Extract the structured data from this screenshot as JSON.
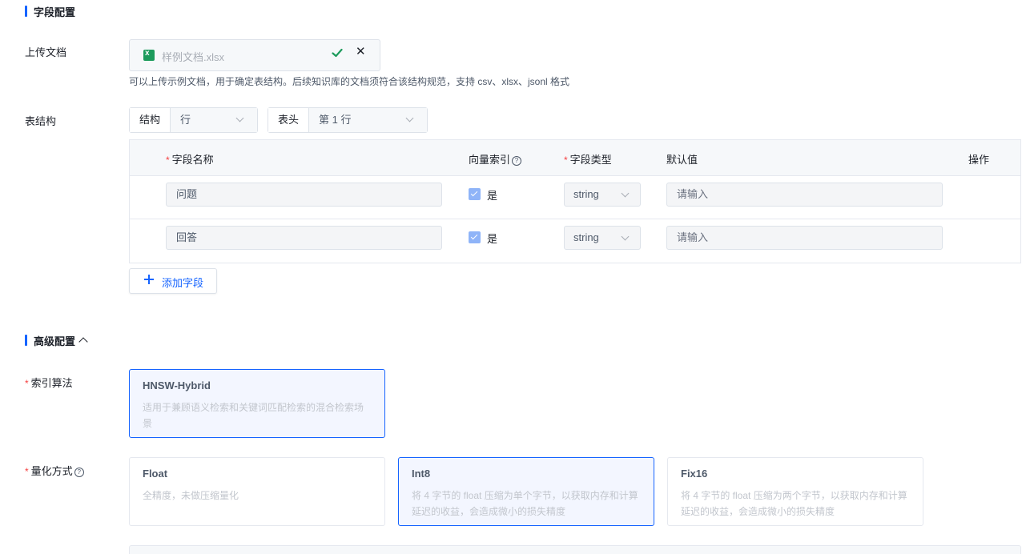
{
  "field_config": {
    "title": "字段配置"
  },
  "upload": {
    "label": "上传文档",
    "file_name": "样例文档.xlsx",
    "hint": "可以上传示例文档，用于确定表结构。后续知识库的文档须符合该结构规范，支持 csv、xlsx、jsonl 格式"
  },
  "table_structure": {
    "label": "表结构",
    "structure": {
      "label": "结构",
      "value": "行"
    },
    "header": {
      "label": "表头",
      "value": "第 1 行"
    }
  },
  "fields_table": {
    "columns": {
      "name": "字段名称",
      "vector_index": "向量索引",
      "type": "字段类型",
      "default": "默认值",
      "action": "操作"
    },
    "rows": [
      {
        "name": "问题",
        "vector_index_checked": true,
        "vector_index_label": "是",
        "type": "string",
        "default_placeholder": "请输入"
      },
      {
        "name": "回答",
        "vector_index_checked": true,
        "vector_index_label": "是",
        "type": "string",
        "default_placeholder": "请输入"
      }
    ]
  },
  "add_field_label": "添加字段",
  "advanced": {
    "title": "高级配置"
  },
  "index_algorithm": {
    "label": "索引算法",
    "options": [
      {
        "title": "HNSW-Hybrid",
        "desc": "适用于兼顾语义检索和关键词匹配检索的混合检索场景",
        "selected": true
      }
    ]
  },
  "quantization": {
    "label": "量化方式",
    "options": [
      {
        "title": "Float",
        "desc": "全精度，未做压缩量化",
        "selected": false
      },
      {
        "title": "Int8",
        "desc": "将 4 字节的 float 压缩为单个字节，以获取内存和计算延迟的收益，会造成微小的损失精度",
        "selected": true
      },
      {
        "title": "Fix16",
        "desc": "将 4 字节的 float 压缩为两个字节，以获取内存和计算延迟的收益，会造成微小的损失精度",
        "selected": false
      }
    ]
  },
  "colors": {
    "accent": "#1664ff",
    "required": "#f53f3f",
    "excel": "#1d9b5c",
    "checkbox": "#8fb4f8"
  }
}
